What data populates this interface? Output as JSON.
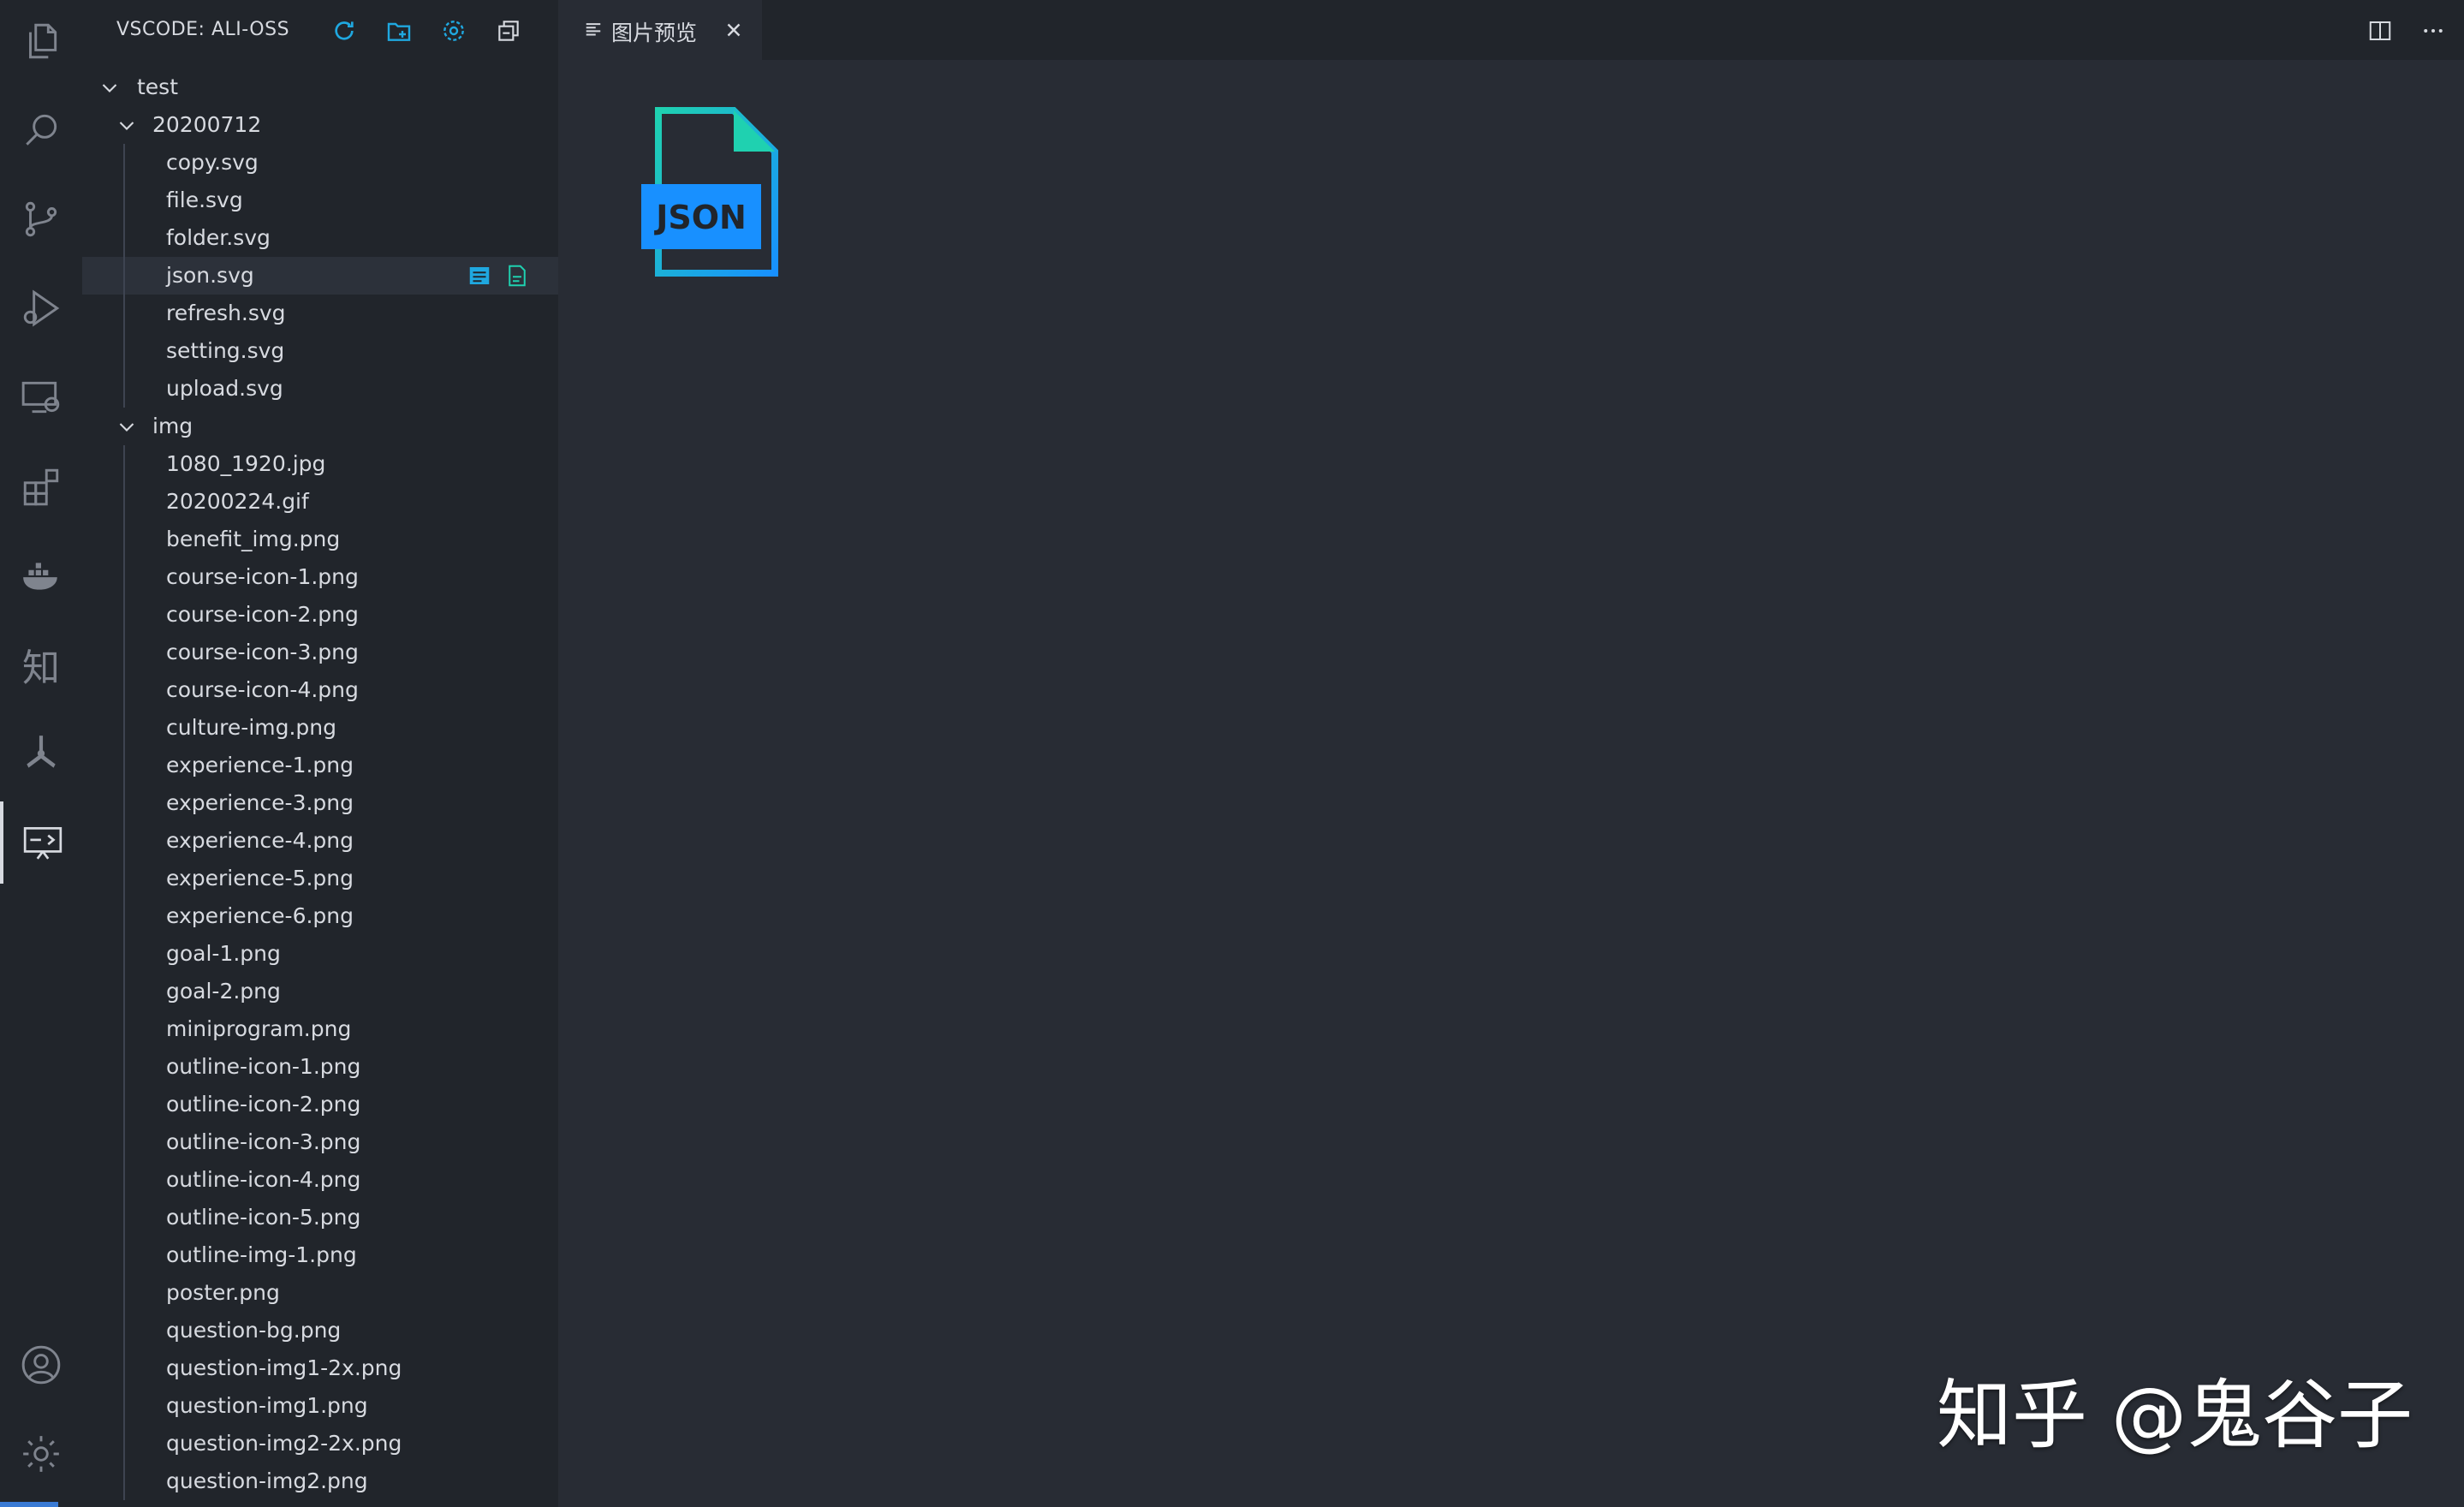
{
  "sidebar": {
    "title": "VSCODE: ALI-OSS",
    "actions": [
      "refresh-icon",
      "new-folder-icon",
      "settings-icon",
      "collapse-all-icon"
    ],
    "tree": [
      {
        "label": "test",
        "type": "folder",
        "level": 0
      },
      {
        "label": "20200712",
        "type": "folder",
        "level": 1
      },
      {
        "label": "copy.svg",
        "type": "file",
        "level": 2
      },
      {
        "label": "file.svg",
        "type": "file",
        "level": 2
      },
      {
        "label": "folder.svg",
        "type": "file",
        "level": 2
      },
      {
        "label": "json.svg",
        "type": "file",
        "level": 2,
        "selected": true
      },
      {
        "label": "refresh.svg",
        "type": "file",
        "level": 2
      },
      {
        "label": "setting.svg",
        "type": "file",
        "level": 2
      },
      {
        "label": "upload.svg",
        "type": "file",
        "level": 2
      },
      {
        "label": "img",
        "type": "folder",
        "level": 1
      },
      {
        "label": "1080_1920.jpg",
        "type": "file",
        "level": 2
      },
      {
        "label": "20200224.gif",
        "type": "file",
        "level": 2
      },
      {
        "label": "benefit_img.png",
        "type": "file",
        "level": 2
      },
      {
        "label": "course-icon-1.png",
        "type": "file",
        "level": 2
      },
      {
        "label": "course-icon-2.png",
        "type": "file",
        "level": 2
      },
      {
        "label": "course-icon-3.png",
        "type": "file",
        "level": 2
      },
      {
        "label": "course-icon-4.png",
        "type": "file",
        "level": 2
      },
      {
        "label": "culture-img.png",
        "type": "file",
        "level": 2
      },
      {
        "label": "experience-1.png",
        "type": "file",
        "level": 2
      },
      {
        "label": "experience-3.png",
        "type": "file",
        "level": 2
      },
      {
        "label": "experience-4.png",
        "type": "file",
        "level": 2
      },
      {
        "label": "experience-5.png",
        "type": "file",
        "level": 2
      },
      {
        "label": "experience-6.png",
        "type": "file",
        "level": 2
      },
      {
        "label": "goal-1.png",
        "type": "file",
        "level": 2
      },
      {
        "label": "goal-2.png",
        "type": "file",
        "level": 2
      },
      {
        "label": "miniprogram.png",
        "type": "file",
        "level": 2
      },
      {
        "label": "outline-icon-1.png",
        "type": "file",
        "level": 2
      },
      {
        "label": "outline-icon-2.png",
        "type": "file",
        "level": 2
      },
      {
        "label": "outline-icon-3.png",
        "type": "file",
        "level": 2
      },
      {
        "label": "outline-icon-4.png",
        "type": "file",
        "level": 2
      },
      {
        "label": "outline-icon-5.png",
        "type": "file",
        "level": 2
      },
      {
        "label": "outline-img-1.png",
        "type": "file",
        "level": 2
      },
      {
        "label": "poster.png",
        "type": "file",
        "level": 2
      },
      {
        "label": "question-bg.png",
        "type": "file",
        "level": 2
      },
      {
        "label": "question-img1-2x.png",
        "type": "file",
        "level": 2
      },
      {
        "label": "question-img1.png",
        "type": "file",
        "level": 2
      },
      {
        "label": "question-img2-2x.png",
        "type": "file",
        "level": 2
      },
      {
        "label": "question-img2.png",
        "type": "file",
        "level": 2
      }
    ]
  },
  "activity_bar": {
    "items": [
      "explorer-icon",
      "search-icon",
      "source-control-icon",
      "run-debug-icon",
      "remote-explorer-icon",
      "extensions-icon",
      "docker-icon",
      "zhihu-icon",
      "fan-icon",
      "ali-oss-icon"
    ],
    "zhihu_glyph": "知",
    "bottom": [
      "account-icon",
      "manage-gear-icon"
    ]
  },
  "editor": {
    "tab_label": "图片预览",
    "preview_badge": "JSON"
  },
  "watermark": "知乎 @鬼谷子",
  "colors": {
    "accent_teal": "#1fd1b0",
    "accent_blue": "#1890ff",
    "background": "#282c34",
    "sidebar": "#21252b"
  }
}
